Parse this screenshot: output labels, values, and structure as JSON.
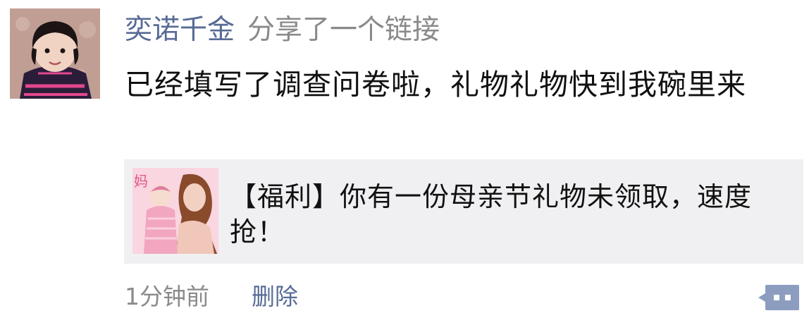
{
  "post": {
    "username": "奕诺千金",
    "action": "分享了一个链接",
    "content": "已经填写了调查问卷啦，礼物礼物快到我碗里来",
    "link": {
      "title": "【福利】你有一份母亲节礼物未领取，速度抢！",
      "thumbnail_text": "妈"
    },
    "timestamp": "1分钟前",
    "delete_label": "删除"
  },
  "icons": {
    "comment": "comment-icon"
  },
  "colors": {
    "name_link": "#576b95",
    "secondary_text": "#8a8a8a",
    "card_bg": "#f0f0f2",
    "comment_icon": "#8c9dc0"
  }
}
